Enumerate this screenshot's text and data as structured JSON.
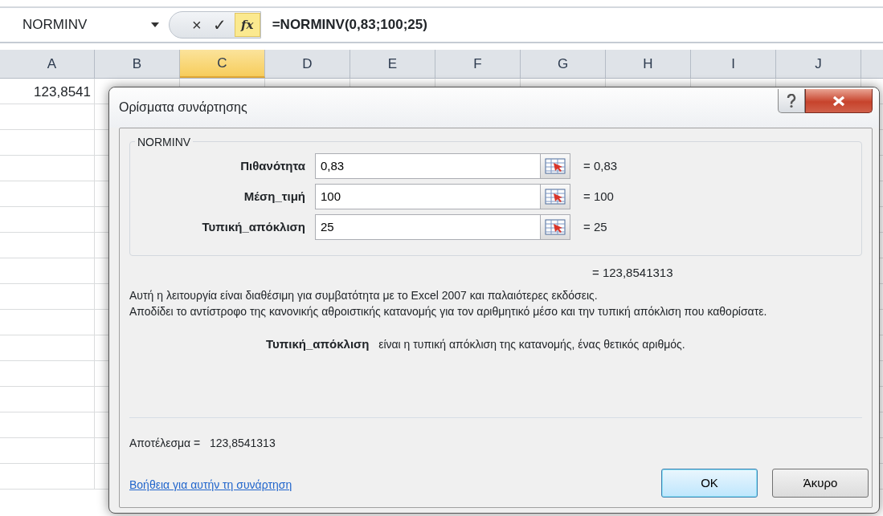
{
  "name_box": {
    "value": "NORMINV"
  },
  "formula_bar": {
    "cancel": "×",
    "enter": "✓",
    "fx": "fx",
    "formula": "=NORMINV(0,83;100;25)"
  },
  "columns": [
    {
      "label": "A",
      "selected": false
    },
    {
      "label": "B",
      "selected": false
    },
    {
      "label": "C",
      "selected": true
    },
    {
      "label": "D",
      "selected": false
    },
    {
      "label": "E",
      "selected": false
    },
    {
      "label": "F",
      "selected": false
    },
    {
      "label": "G",
      "selected": false
    },
    {
      "label": "H",
      "selected": false
    },
    {
      "label": "I",
      "selected": false
    },
    {
      "label": "J",
      "selected": false
    }
  ],
  "rows": [
    {
      "cells": [
        "123,8541"
      ]
    }
  ],
  "dialog": {
    "title": "Ορίσματα συνάρτησης",
    "group_title": "NORMINV",
    "arguments": [
      {
        "label": "Πιθανότητα",
        "value": "0,83",
        "result": "= 0,83"
      },
      {
        "label": "Μέση_τιμή",
        "value": "100",
        "result": "= 100"
      },
      {
        "label": "Τυπική_απόκλιση",
        "value": "25",
        "result": "= 25"
      }
    ],
    "formula_result": "= 123,8541313",
    "description": [
      "Αυτή η λειτουργία είναι διαθέσιμη για συμβατότητα με το Excel 2007 και παλαιότερες εκδόσεις.",
      "Αποδίδει το αντίστροφο της κανονικής αθροιστικής κατανομής για τον αριθμητικό μέσο και την τυπική απόκλιση που καθορίσατε."
    ],
    "argument_help": {
      "name": "Τυπική_απόκλιση",
      "text": "είναι η τυπική απόκλιση της κατανομής, ένας θετικός αριθμός."
    },
    "result_label": "Αποτέλεσμα =",
    "result_value": "123,8541313",
    "help_link": "Βοήθεια για αυτήν τη συνάρτηση",
    "buttons": [
      {
        "label": "OK",
        "default": true
      },
      {
        "label": "Άκυρο",
        "default": false
      }
    ]
  }
}
